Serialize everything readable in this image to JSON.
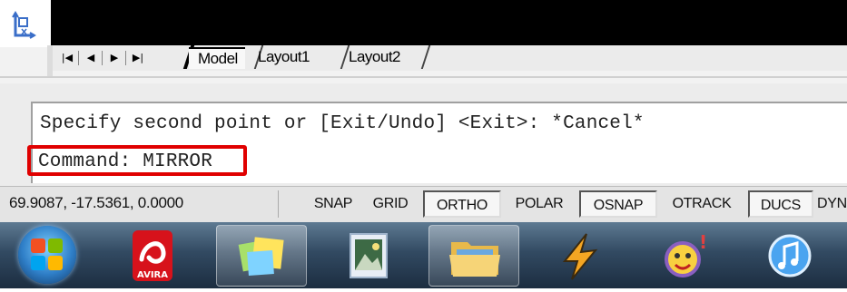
{
  "tabs": {
    "nav": [
      "|◀",
      "◀",
      "▶",
      "▶|"
    ],
    "items": [
      "Model",
      "Layout1",
      "Layout2"
    ]
  },
  "command": {
    "line1": "Specify second point or [Exit/Undo] <Exit>: *Cancel*",
    "line2": "Command: MIRROR"
  },
  "status": {
    "coords": "69.9087, -17.5361, 0.0000",
    "buttons": [
      {
        "label": "SNAP",
        "on": false
      },
      {
        "label": "GRID",
        "on": false
      },
      {
        "label": "ORTHO",
        "on": true
      },
      {
        "label": "POLAR",
        "on": false
      },
      {
        "label": "OSNAP",
        "on": true
      },
      {
        "label": "OTRACK",
        "on": false
      },
      {
        "label": "DUCS",
        "on": true
      },
      {
        "label": "DYN",
        "on": false
      }
    ]
  },
  "taskbar": {
    "avira_label": "AVIRA",
    "items": [
      "start-orb",
      "avira-icon",
      "sticky-notes-icon",
      "photo-viewer-icon",
      "file-explorer-icon",
      "winamp-icon",
      "yahoo-messenger-icon",
      "itunes-icon"
    ]
  },
  "colors": {
    "highlight": "#e00000"
  }
}
